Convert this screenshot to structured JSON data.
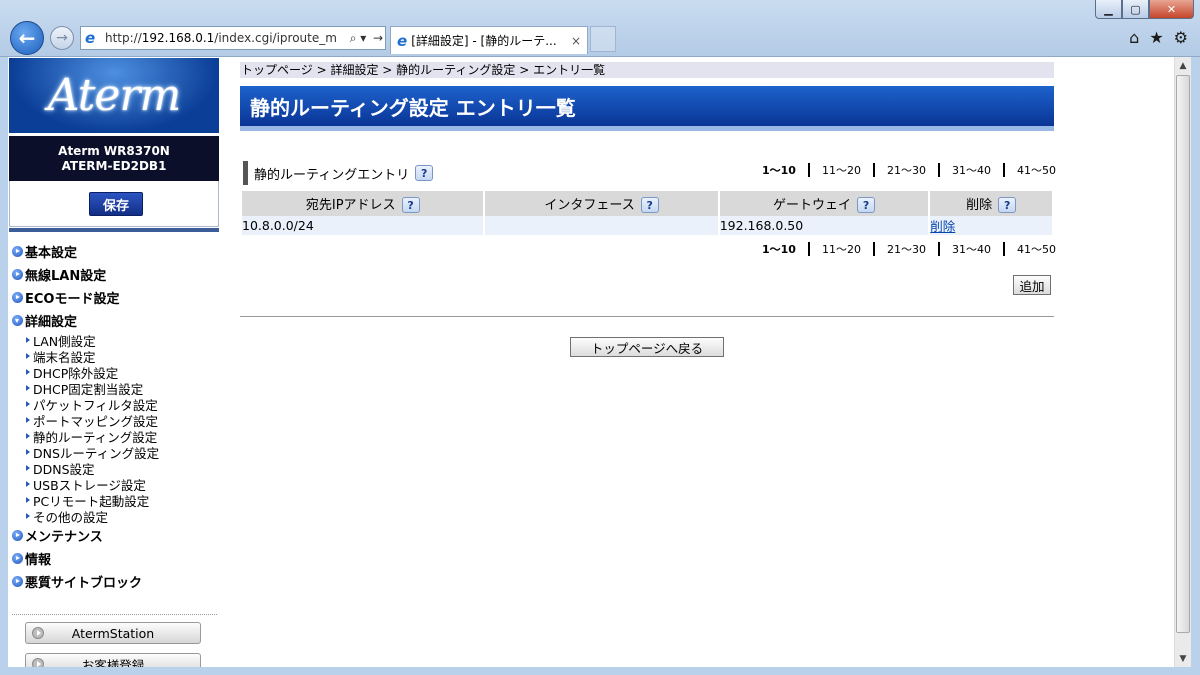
{
  "browser": {
    "address_prefix": "http://",
    "address_host": "192.168.0.1",
    "address_path": "/index.cgi/iproute_m",
    "tab_title": "[詳細設定] - [静的ルーテ...",
    "search_glyph": "⌕ ▾",
    "go_glyph": "→",
    "close_glyph": "×"
  },
  "sidebar": {
    "logo": "Aterm",
    "model_line1": "Aterm WR8370N",
    "model_line2": "ATERM-ED2DB1",
    "save_label": "保存",
    "menu": [
      {
        "label": "基本設定"
      },
      {
        "label": "無線LAN設定"
      },
      {
        "label": "ECOモード設定"
      },
      {
        "label": "詳細設定"
      },
      {
        "label": "メンテナンス"
      },
      {
        "label": "情報"
      },
      {
        "label": "悪質サイトブロック"
      }
    ],
    "submenu": [
      "LAN側設定",
      "端末名設定",
      "DHCP除外設定",
      "DHCP固定割当設定",
      "パケットフィルタ設定",
      "ポートマッピング設定",
      "静的ルーティング設定",
      "DNSルーティング設定",
      "DDNS設定",
      "USBストレージ設定",
      "PCリモート起動設定",
      "その他の設定"
    ],
    "buttons": [
      "AtermStation",
      "お客様登録"
    ]
  },
  "main": {
    "breadcrumb": "トップページ > 詳細設定 > 静的ルーティング設定 > エントリ一覧",
    "title": "静的ルーティング設定 エントリ一覧",
    "section_title": "静的ルーティングエントリ",
    "help_glyph": "?",
    "pager": [
      "1〜10",
      "11〜20",
      "21〜30",
      "31〜40",
      "41〜50"
    ],
    "table": {
      "headers": [
        "宛先IPアドレス",
        "インタフェース",
        "ゲートウェイ",
        "削除"
      ],
      "rows": [
        {
          "dest": "10.8.0.0/24",
          "iface": "",
          "gateway": "192.168.0.50",
          "delete": "削除"
        }
      ]
    },
    "add_label": "追加",
    "back_label": "トップページへ戻る"
  }
}
